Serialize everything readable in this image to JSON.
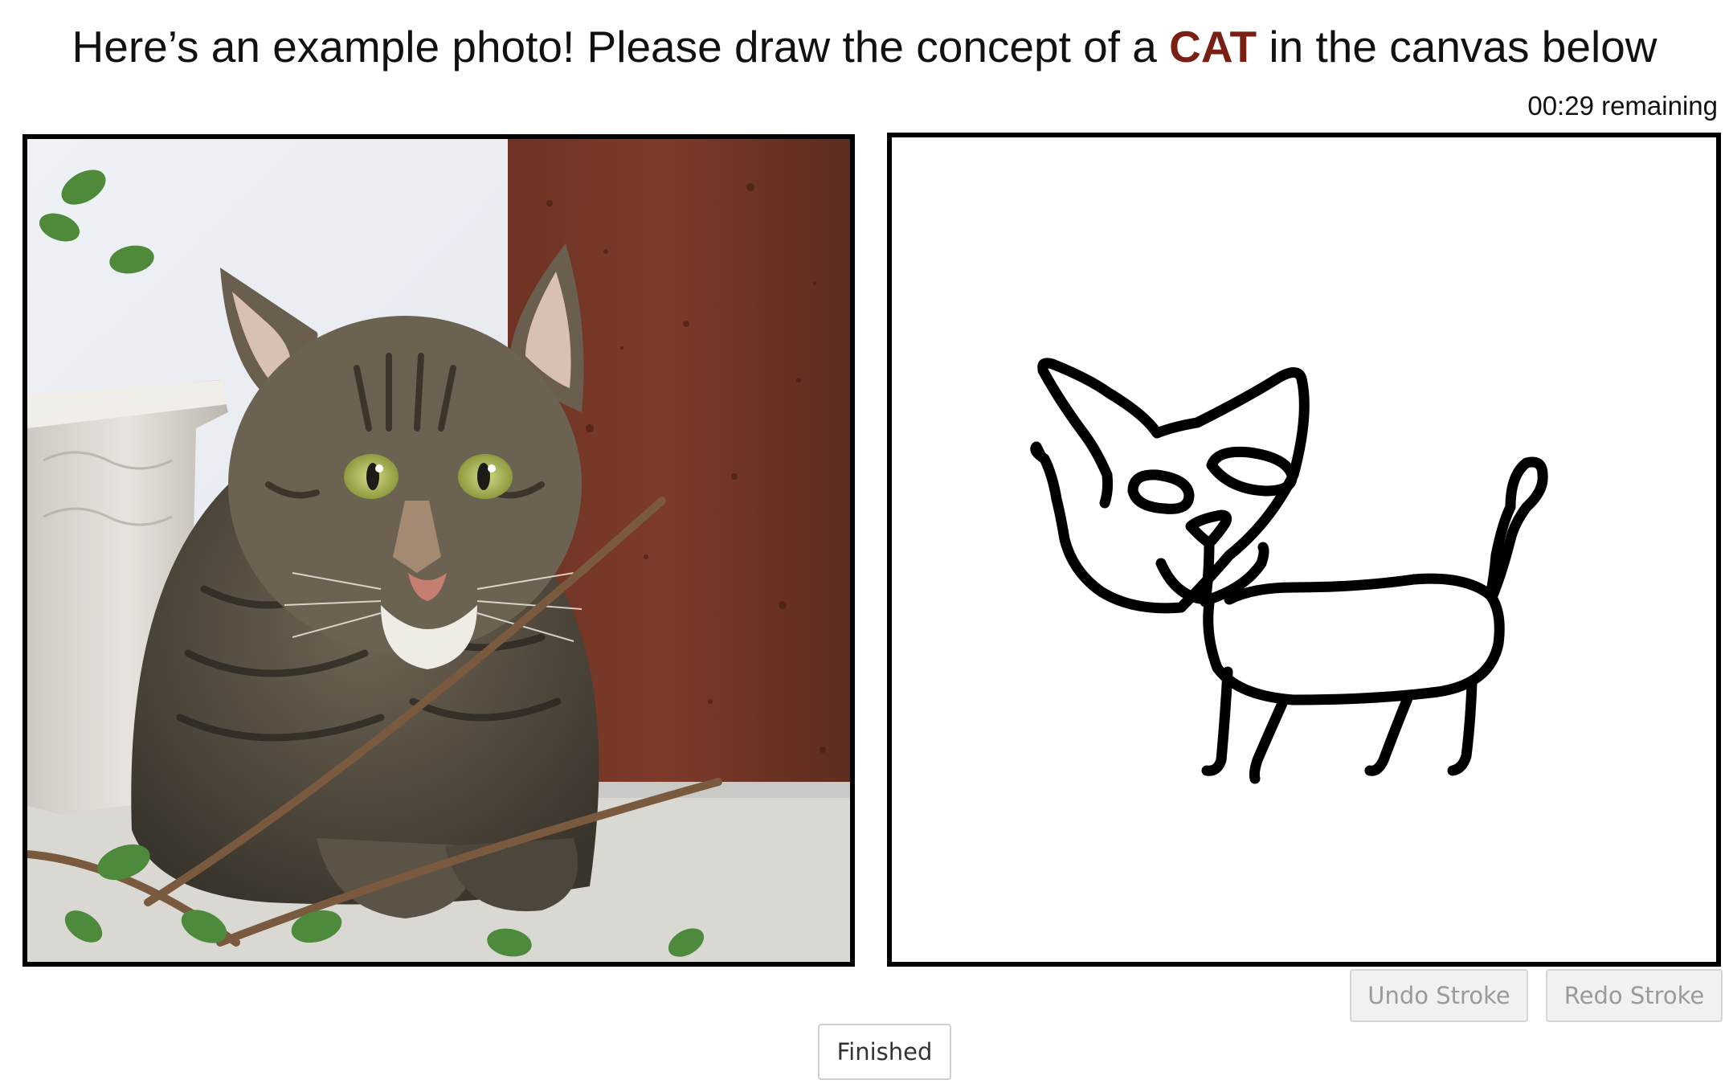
{
  "header": {
    "prompt_before": "Here’s an example photo! Please draw the concept of a ",
    "concept": "CAT",
    "prompt_after": " in the canvas below",
    "concept_color": "#7a1f14"
  },
  "timer": {
    "text": "00:29 remaining"
  },
  "example_photo": {
    "subject": "tabby cat lying beside a white flower pot and a rusty brown post"
  },
  "canvas": {
    "drawing": "hand-drawn black outline of a cat",
    "stroke_color": "#000000"
  },
  "controls": {
    "undo_label": "Undo Stroke",
    "redo_label": "Redo Stroke",
    "finished_label": "Finished"
  }
}
